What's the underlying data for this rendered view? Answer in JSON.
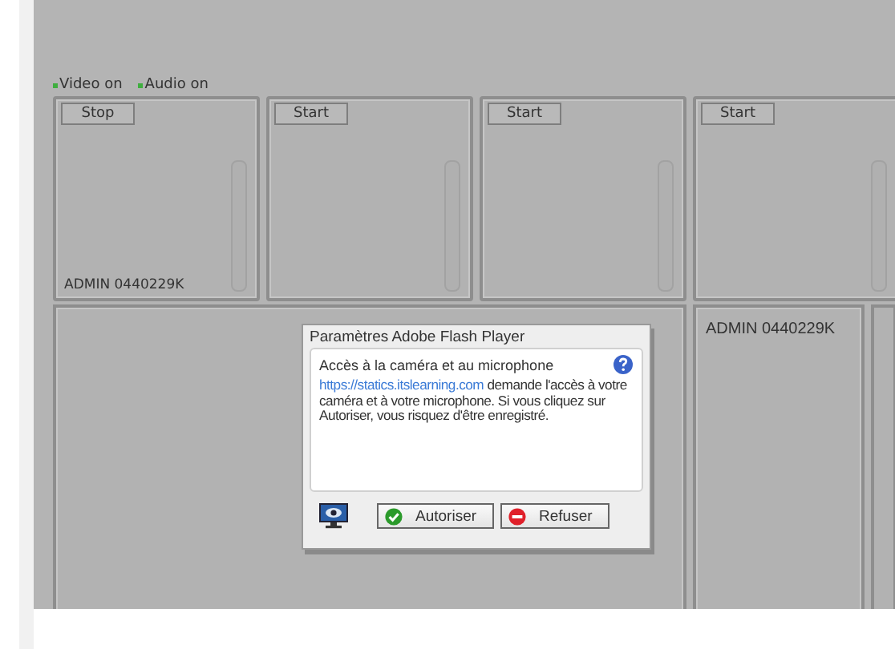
{
  "indicators": [
    {
      "label": "Video on",
      "on": true
    },
    {
      "label": "Audio on",
      "on": true
    }
  ],
  "tiles": [
    {
      "button": "Stop",
      "user": "ADMIN 0440229K"
    },
    {
      "button": "Start"
    },
    {
      "button": "Start"
    },
    {
      "button": "Start"
    }
  ],
  "side_tile": {
    "user": "ADMIN 0440229K"
  },
  "dialog": {
    "title": "Paramètres Adobe Flash Player",
    "heading": "Accès à la caméra et au microphone",
    "link": "https://statics.itslearning.com",
    "message": " demande l'accès à votre caméra et à votre microphone. Si vous cliquez sur Autoriser, vous risquez d'être enregistré.",
    "buttons": [
      {
        "label": "Autoriser",
        "kind": "allow"
      },
      {
        "label": "Refuser",
        "kind": "deny"
      }
    ]
  }
}
